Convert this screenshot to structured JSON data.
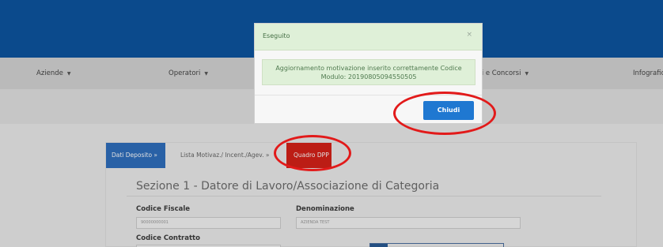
{
  "menu": {
    "items": [
      {
        "label": "Aziende",
        "caret": "▼"
      },
      {
        "label": "Operatori",
        "caret": "▼"
      },
      {
        "label": "ndi e Concorsi",
        "caret": "▼"
      },
      {
        "label": "Infografic",
        "caret": ""
      }
    ]
  },
  "tabs": {
    "dati": "Dati Deposito »",
    "lista": "Lista Motivaz./ Incent./Agev. »",
    "quadro": "Quadro DPP"
  },
  "section": {
    "title": "Sezione 1 - Datore di Lavoro/Associazione di Categoria"
  },
  "form": {
    "codice_fiscale_label": "Codice Fiscale",
    "codice_fiscale_value": "90000000001",
    "denominazione_label": "Denominazione",
    "denominazione_value": "AZIENDA TEST",
    "codice_contratto_label": "Codice Contratto"
  },
  "modal": {
    "title": "Eseguito",
    "close_symbol": "×",
    "message_line1": "Aggiornamento motivazione inserito correttamente Codice",
    "message_line2": "Modulo: 20190805094550505",
    "button_label": "Chiudi"
  },
  "colors": {
    "topbar": "#0d55a0",
    "success_bg": "#dff0d8",
    "primary_button": "#1f78d1",
    "tab_active": "#2f6fbd",
    "tab_red": "#d62219",
    "annotation_ring": "#e21a1a"
  }
}
